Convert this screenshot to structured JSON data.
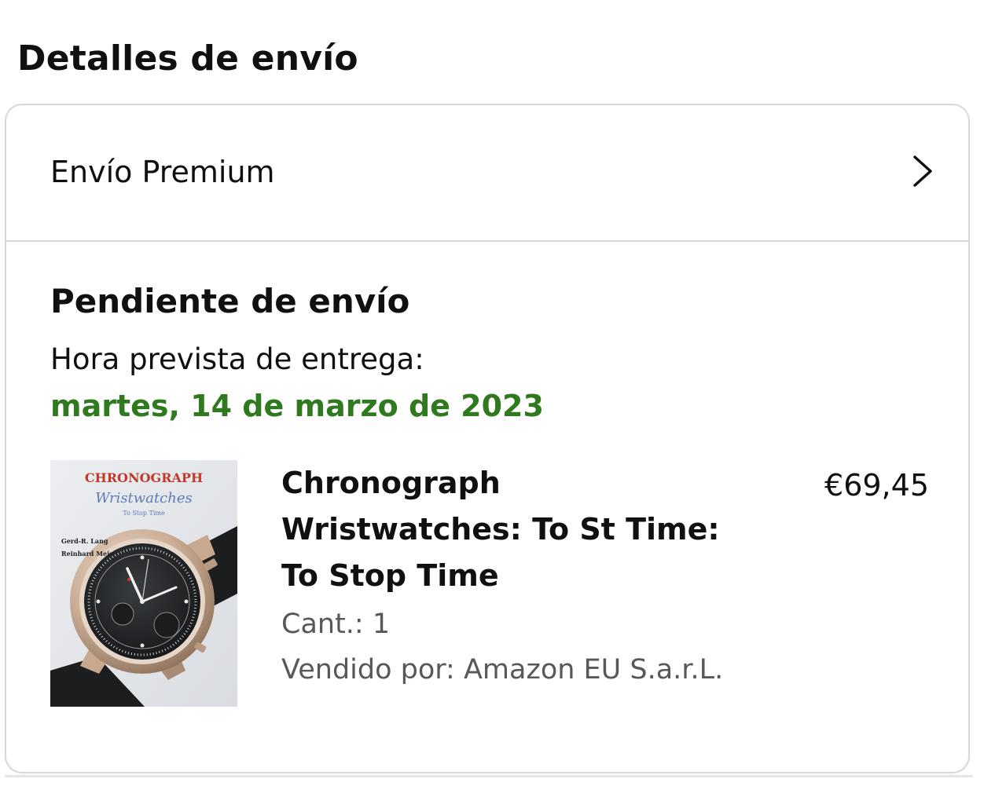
{
  "header": {
    "title": "Detalles de envío"
  },
  "shipping": {
    "method_label": "Envío Premium",
    "chevron_icon": "chevron-right-icon"
  },
  "shipment": {
    "status_title": "Pendiente de envío",
    "delivery_label": "Hora prevista de entrega:",
    "delivery_date": "martes, 14 de marzo de 2023",
    "date_color": "#2f7a1f"
  },
  "product": {
    "title_lines": [
      "Chronograph",
      "Wristwatches: To St Time:",
      "To Stop Time"
    ],
    "price": "€69,45",
    "quantity": "Cant.: 1",
    "seller": "Vendido por: Amazon EU S.a.r.L.",
    "cover": {
      "title": "CHRONOGRAPH",
      "subtitle": "Wristwatches",
      "tagline": "To Stop Time",
      "author_1": "Gerd-R. Lang",
      "author_2": "Reinhard Meis"
    }
  },
  "colors": {
    "border": "#d5d9d9",
    "secondary_text": "#565959",
    "cover_title": "#c0392b",
    "cover_subtitle": "#5a7db8"
  }
}
